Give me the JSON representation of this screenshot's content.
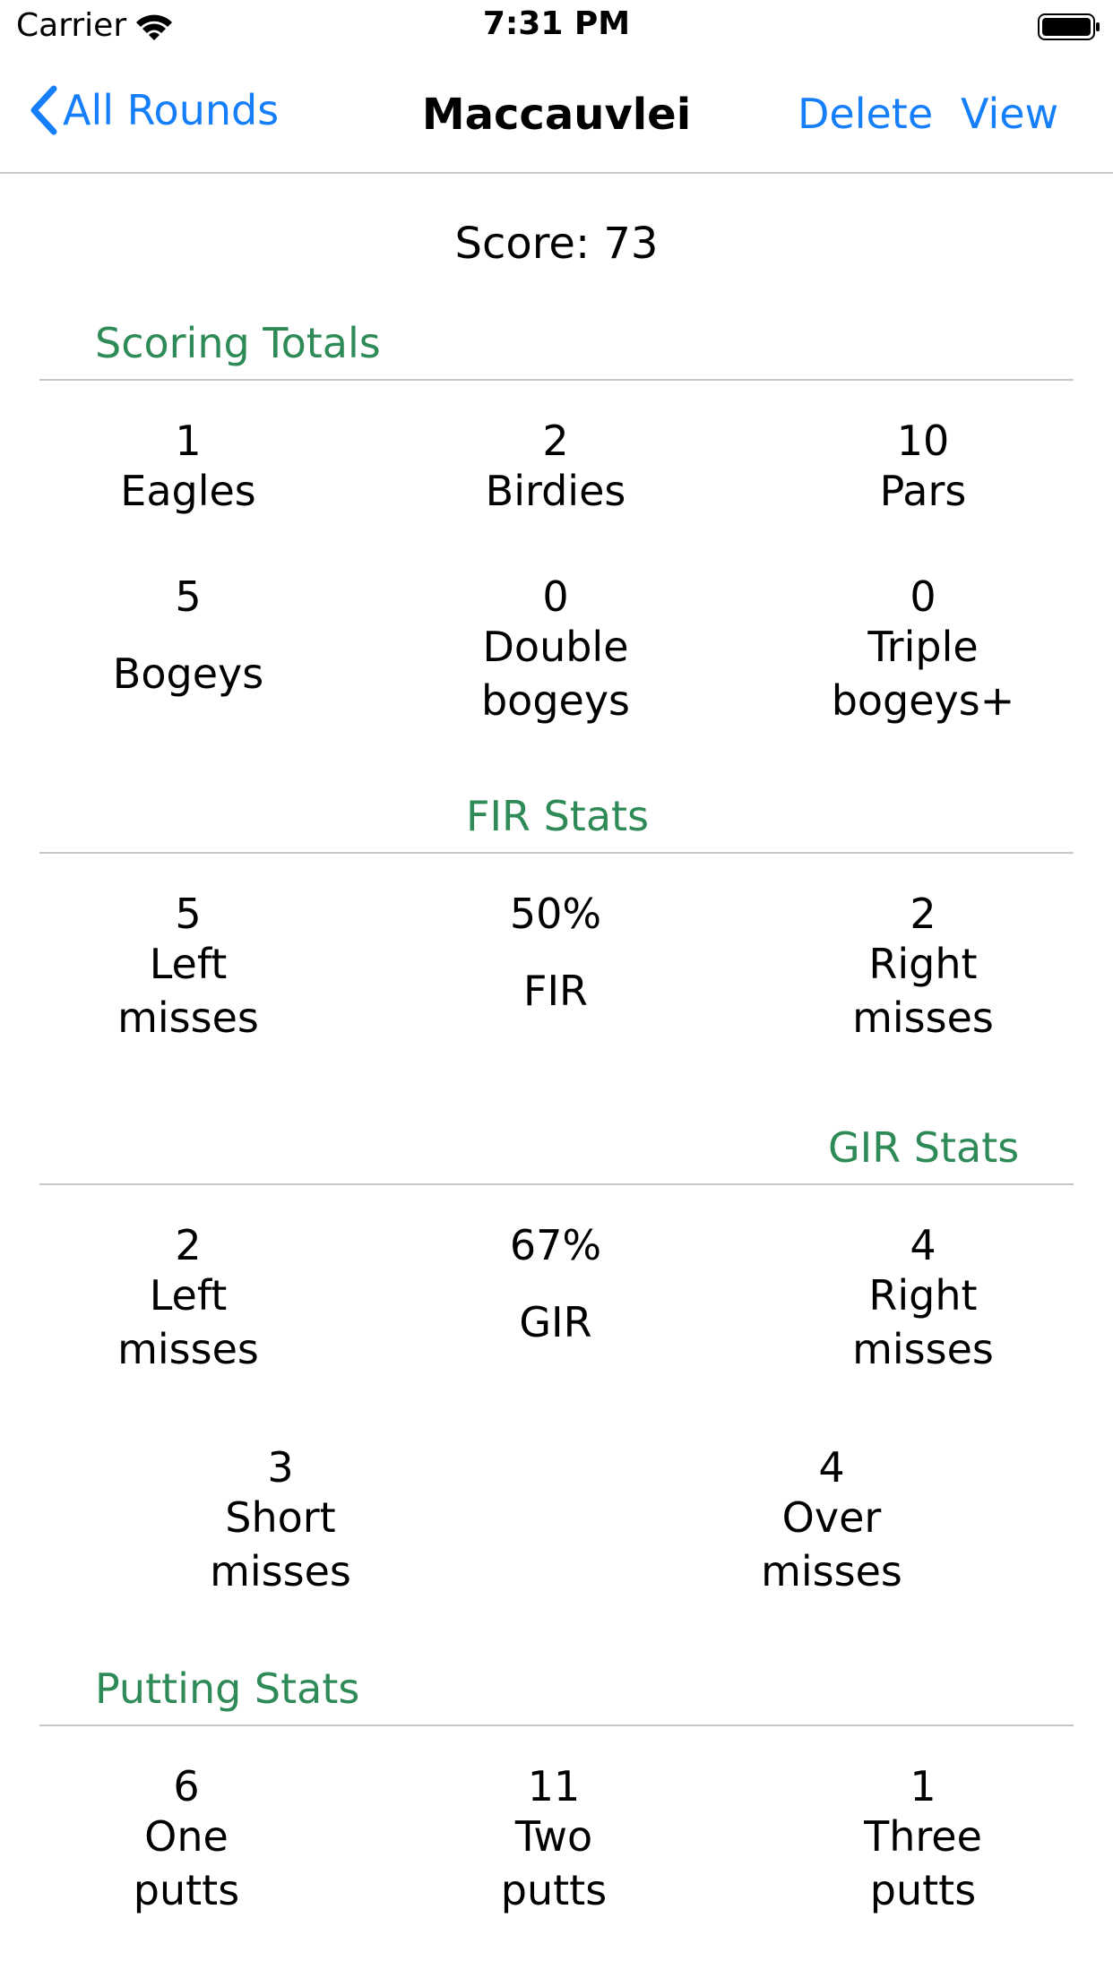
{
  "status_bar": {
    "carrier": "Carrier",
    "time": "7:31 PM"
  },
  "nav": {
    "back_label": "All Rounds",
    "title": "Maccauvlei",
    "delete_label": "Delete",
    "view_label": "View"
  },
  "score": {
    "label": "Score:",
    "value": "73"
  },
  "sections": {
    "scoring": "Scoring Totals",
    "fir": "FIR Stats",
    "gir": "GIR Stats",
    "putting": "Putting Stats"
  },
  "scoring": {
    "eagles": {
      "value": "1",
      "label": "Eagles"
    },
    "birdies": {
      "value": "2",
      "label": "Birdies"
    },
    "pars": {
      "value": "10",
      "label": "Pars"
    },
    "bogeys": {
      "value": "5",
      "label": "Bogeys"
    },
    "double_bogeys": {
      "value": "0",
      "label_1": "Double",
      "label_2": "bogeys"
    },
    "triple_bogeys": {
      "value": "0",
      "label_1": "Triple",
      "label_2": "bogeys+"
    }
  },
  "fir": {
    "left": {
      "value": "5",
      "label_1": "Left",
      "label_2": "misses"
    },
    "pct": {
      "value": "50%",
      "label": "FIR"
    },
    "right": {
      "value": "2",
      "label_1": "Right",
      "label_2": "misses"
    }
  },
  "gir": {
    "left": {
      "value": "2",
      "label_1": "Left",
      "label_2": "misses"
    },
    "pct": {
      "value": "67%",
      "label": "GIR"
    },
    "right": {
      "value": "4",
      "label_1": "Right",
      "label_2": "misses"
    },
    "short": {
      "value": "3",
      "label_1": "Short",
      "label_2": "misses"
    },
    "over": {
      "value": "4",
      "label_1": "Over",
      "label_2": "misses"
    }
  },
  "putting": {
    "one": {
      "value": "6",
      "label_1": "One",
      "label_2": "putts"
    },
    "two": {
      "value": "11",
      "label_1": "Two",
      "label_2": "putts"
    },
    "three": {
      "value": "1",
      "label_1": "Three",
      "label_2": "putts"
    }
  },
  "colors": {
    "accent": "#147efb",
    "section": "#2e8b57",
    "separator": "#c8c7cc"
  }
}
